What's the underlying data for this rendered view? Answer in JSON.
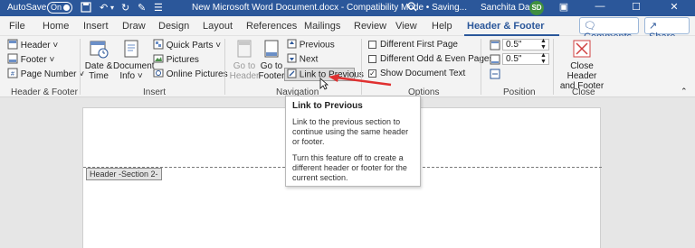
{
  "title_bar": {
    "autosave_label": "AutoSave",
    "autosave_state": "On",
    "doc_title": "New Microsoft Word Document.docx  -  Compatibility Mode • Saving...",
    "user_name": "Sanchita Das",
    "user_initials": "SD",
    "accent": "#2b579a"
  },
  "tabs": [
    "File",
    "Home",
    "Insert",
    "Draw",
    "Design",
    "Layout",
    "References",
    "Mailings",
    "Review",
    "View",
    "Help",
    "Header & Footer"
  ],
  "active_tab": "Header & Footer",
  "comments_label": "Comments",
  "share_label": "Share",
  "ribbon": {
    "header_footer_group": {
      "label": "Header & Footer",
      "header": "Header",
      "footer": "Footer",
      "page_number": "Page Number"
    },
    "insert_group": {
      "label": "Insert",
      "date_time_l1": "Date &",
      "date_time_l2": "Time",
      "doc_info_l1": "Document",
      "doc_info_l2": "Info",
      "quick_parts": "Quick Parts",
      "pictures": "Pictures",
      "online_pictures": "Online Pictures"
    },
    "navigation_group": {
      "label": "Navigation",
      "goto_header_l1": "Go to",
      "goto_header_l2": "Header",
      "goto_footer_l1": "Go to",
      "goto_footer_l2": "Footer",
      "previous": "Previous",
      "next": "Next",
      "link_to_previous": "Link to Previous"
    },
    "options_group": {
      "label": "Options",
      "different_first_page": "Different First Page",
      "different_odd_even": "Different Odd & Even Pages",
      "show_document_text": "Show Document Text",
      "show_document_text_checked": true
    },
    "position_group": {
      "label": "Position",
      "header_from_top": "0.5\"",
      "footer_from_bottom": "0.5\""
    },
    "close_group": {
      "label": "Close",
      "close_l1": "Close Header",
      "close_l2": "and Footer"
    }
  },
  "tooltip": {
    "title": "Link to Previous",
    "body1": "Link to the previous section to continue using the same header or footer.",
    "body2": "Turn this feature off to create a different header or footer for the current section."
  },
  "document": {
    "section_tag": "Header -Section 2-"
  }
}
